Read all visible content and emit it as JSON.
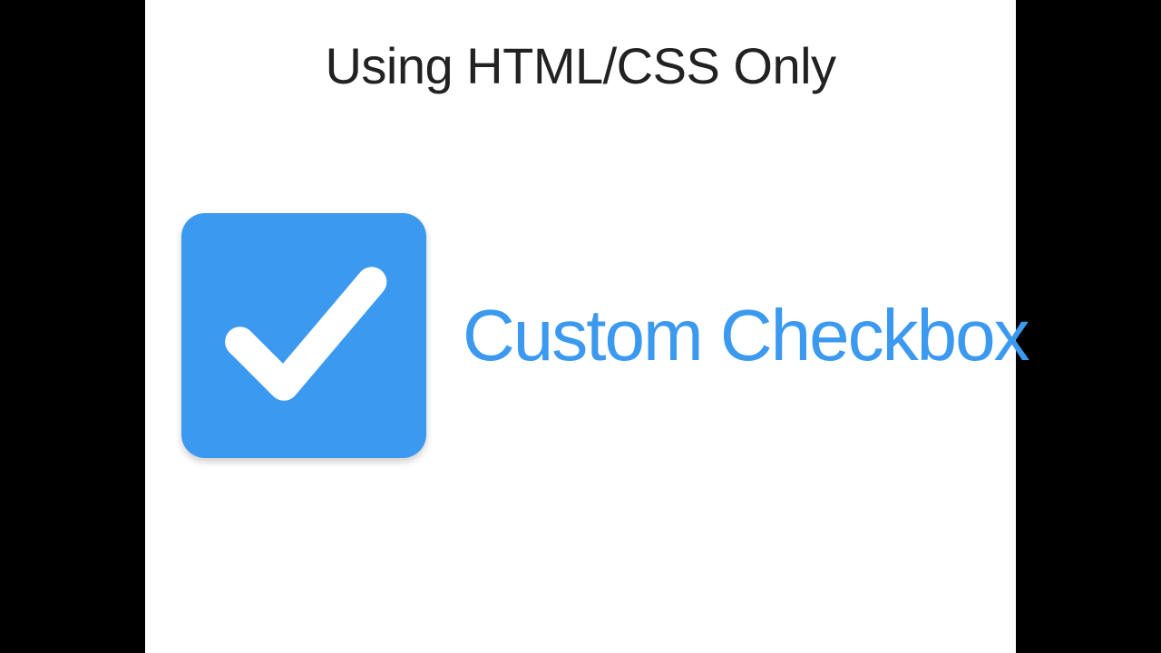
{
  "colors": {
    "accent": "#3b99ef",
    "heading": "#222222",
    "bg": "#ffffff"
  },
  "header": {
    "subtitle": "Using HTML/CSS Only"
  },
  "main": {
    "title": "Custom Checkbox",
    "icon": "checkmark-icon"
  }
}
